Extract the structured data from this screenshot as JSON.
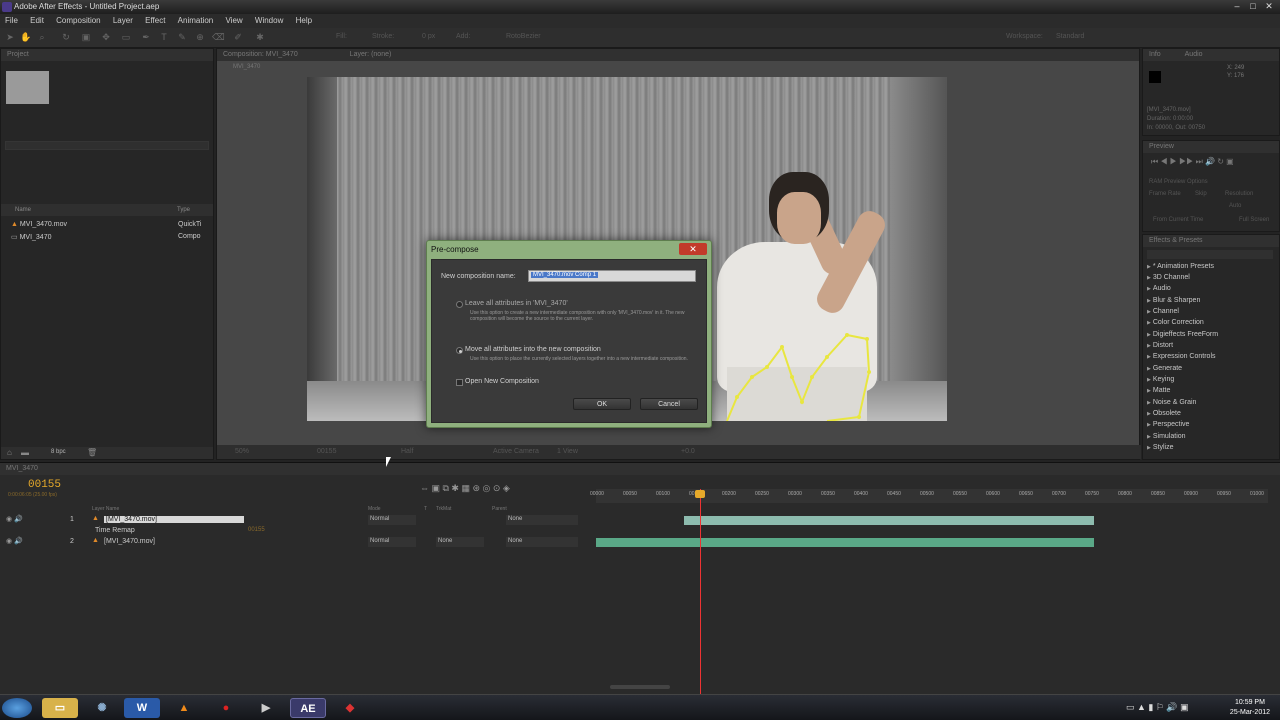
{
  "window": {
    "title": "Adobe After Effects - Untitled Project.aep"
  },
  "menu": [
    "File",
    "Edit",
    "Composition",
    "Layer",
    "Effect",
    "Animation",
    "View",
    "Window",
    "Help"
  ],
  "toolbar": {
    "fill_label": "Fill:",
    "stroke_label": "Stroke:",
    "stroke_px": "0 px",
    "add_label": "Add:",
    "rotobezier_label": "RotoBezier",
    "workspace_label": "Workspace:",
    "workspace_value": "Standard"
  },
  "project": {
    "tab": "Project",
    "col_name": "Name",
    "col_type": "Type",
    "items": [
      {
        "name": "MVI_3470.mov",
        "type": "QuickTi"
      },
      {
        "name": "MVI_3470",
        "type": "Compo"
      }
    ],
    "bpc": "8 bpc"
  },
  "composition": {
    "tab": "Composition: MVI_3470",
    "layer_tab": "Layer: (none)",
    "crumb": "MVI_3470",
    "zoom": "50%",
    "timecode": "00155",
    "quality": "Half",
    "camera": "Active Camera",
    "view": "1 View",
    "exposure": "+0.0"
  },
  "info": {
    "tab": "Info",
    "audio_tab": "Audio",
    "x": "X: 249",
    "y": "Y: 176",
    "layer_name": "[MVI_3470.mov]",
    "duration": "Duration: 0:00:00",
    "in_out": "In: 00000, Out: 00750"
  },
  "preview": {
    "tab": "Preview",
    "ram_options": "RAM Preview Options",
    "frame_rate": "Frame Rate",
    "skip": "Skip",
    "resolution": "Resolution",
    "auto": "Auto",
    "from_current": "From Current Time",
    "full_screen": "Full Screen"
  },
  "effects": {
    "tab": "Effects & Presets",
    "items": [
      "* Animation Presets",
      "3D Channel",
      "Audio",
      "Blur & Sharpen",
      "Channel",
      "Color Correction",
      "Digieffects FreeForm",
      "Distort",
      "Expression Controls",
      "Generate",
      "Keying",
      "Matte",
      "Noise & Grain",
      "Obsolete",
      "Perspective",
      "Simulation",
      "Stylize"
    ]
  },
  "timeline": {
    "tab": "MVI_3470",
    "timecode": "00155",
    "timecode_sub": "0:00:06:05 (25.00 fps)",
    "col_layer_name": "Layer Name",
    "col_mode": "Mode",
    "col_t": "T",
    "col_trkmat": "TrkMat",
    "col_parent": "Parent",
    "ruler_ticks": [
      "00000",
      "00050",
      "00100",
      "00150",
      "00200",
      "00250",
      "00300",
      "00350",
      "00400",
      "00450",
      "00500",
      "00550",
      "00600",
      "00650",
      "00700",
      "00750",
      "00800",
      "00850",
      "00900",
      "00950",
      "01000"
    ],
    "layers": [
      {
        "num": "1",
        "name": "[MVI_3470.mov]",
        "mode": "Normal",
        "trkmat": "",
        "parent": "None"
      },
      {
        "num": "",
        "name": "Time Remap",
        "mode": "",
        "trkmat": "",
        "parent": ""
      },
      {
        "num": "2",
        "name": "[MVI_3470.mov]",
        "mode": "Normal",
        "trkmat": "None",
        "parent": "None"
      }
    ],
    "remap_value": "00155"
  },
  "dialog": {
    "title": "Pre-compose",
    "name_label": "New composition name:",
    "name_value": "MVI_3470.mov Comp 1",
    "opt1_label": "Leave all attributes in 'MVI_3470'",
    "opt1_note": "Use this option to create a new intermediate composition with only 'MVI_3470.mov' in it. The new composition will become the source to the current layer.",
    "opt2_label": "Move all attributes into the new composition",
    "opt2_note": "Use this option to place the currently selected layers together into a new intermediate composition.",
    "open_label": "Open New Composition",
    "ok": "OK",
    "cancel": "Cancel"
  },
  "taskbar": {
    "time": "10:59 PM",
    "date": "25-Mar-2012",
    "apps": [
      "word-icon",
      "vlc-icon",
      "opera-icon",
      "media-icon",
      "after-effects-icon",
      "player-icon"
    ],
    "ae_label": "AE",
    "word_label": "W"
  }
}
